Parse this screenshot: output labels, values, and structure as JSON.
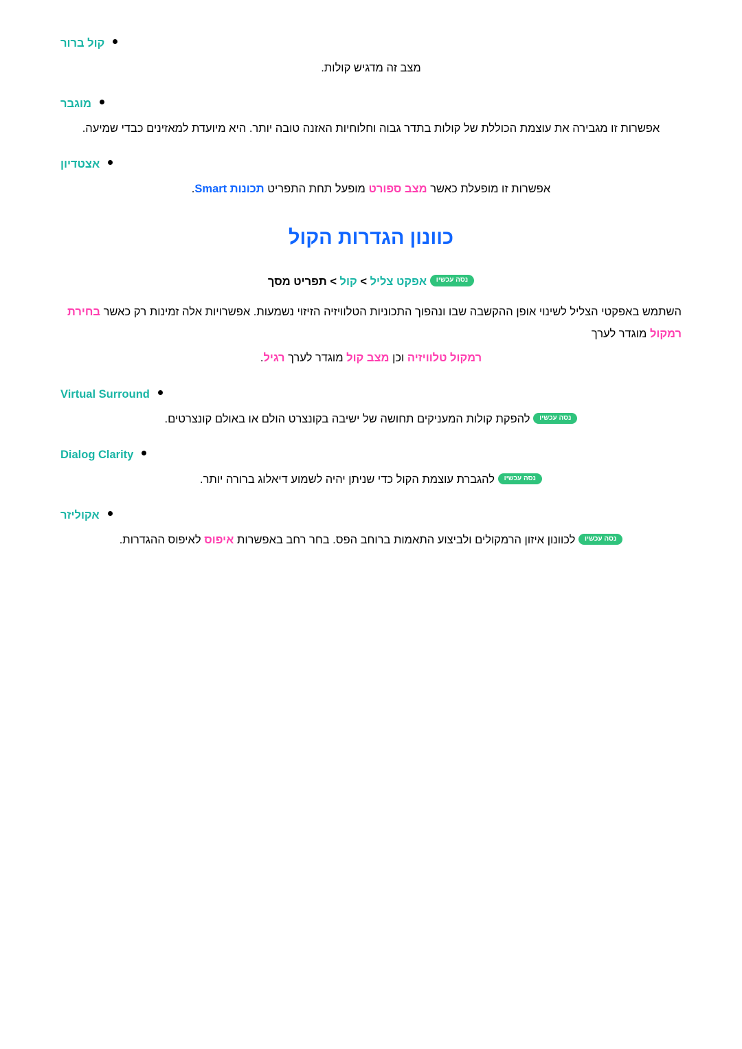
{
  "document": {
    "language": "he",
    "accent_colors": {
      "teal_heading": "#19b5a5",
      "blue_title": "#1166ff",
      "pink_highlight": "#ff3fb0",
      "green_pill": "#2fc37c"
    },
    "try_now_label": "נסה עכשיו",
    "top_items": [
      {
        "id": "clear-sound",
        "label": "קול ברור",
        "description": "מצב זה מדגיש קולות."
      },
      {
        "id": "amplify",
        "label": "מוגבר",
        "description": "אפשרות זו מגבירה את עוצמת הכוללת של קולות בתדר גבוה וחלוחיות האזנה טובה יותר. היא מיועדת למאזינים כבדי שמיעה."
      },
      {
        "id": "adjustment",
        "label": "אצטדיון",
        "description_parts": [
          {
            "text": "אפשרות זו מופעלת כאשר ",
            "style": "plain"
          },
          {
            "text": "מצב ספורט",
            "style": "pink"
          },
          {
            "text": " מופעל תחת התפריט ",
            "style": "plain"
          },
          {
            "text": "תכונות Smart",
            "style": "blue"
          },
          {
            "text": ".",
            "style": "plain"
          }
        ],
        "description_plain": "אפשרות זו מופעלת כאשר מצב ספורט מופעל תחת התפריט תכונות Smart."
      }
    ],
    "section": {
      "title": "כוונון הגדרות הקול",
      "menu_path": {
        "prefix": "תפריט מסך",
        "separator": " > ",
        "items": [
          "קול",
          "אפקט צליל"
        ],
        "full": "תפריט מסך > קול > אפקט צליל"
      },
      "intro_parts": [
        {
          "text": "השתמש באפקטי הצליל לשינוי אופן ההקשבה שבו ונהפוך התכוניות הטלוויזיה הזיזוי נשמעות. אפשרויות אלה זמינות רק כאשר ",
          "style": "plain"
        },
        {
          "text": "בחירת רמקול",
          "style": "pink"
        },
        {
          "text": " מוגדר לערך ",
          "style": "plain"
        },
        {
          "text": "רמקול טלוויזיה",
          "style": "pink"
        },
        {
          "text": " וכן ",
          "style": "plain"
        },
        {
          "text": "מצב קול",
          "style": "pink"
        },
        {
          "text": " מוגדר לערך ",
          "style": "plain"
        },
        {
          "text": "רגיל",
          "style": "pink"
        },
        {
          "text": ".",
          "style": "plain"
        }
      ],
      "intro_line1": "השתמש באפקטי הצליל לשינוי אופן ההקשבה שבו ונהפוך התכוניות הטלוויזיה הזיזוי נשמעות. אפשרויות אלה זמינות רק כאשר בחירת רמקול מוגדר לערך",
      "intro_line2": "רמקול טלוויזיה וכן מצב קול מוגדר לערך רגיל.",
      "effects": [
        {
          "id": "virtual-surround",
          "label": "Virtual Surround",
          "latin": true,
          "description": "להפקת קולות המעניקים תחושה של ישיבה בקונצרט הולם או באולם קונצרטים.",
          "has_try_now": true
        },
        {
          "id": "dialog-clarity",
          "label": "Dialog Clarity",
          "latin": true,
          "description": "להגברת עוצמת הקול כדי שניתן יהיה לשמוע דיאלוג ברורה יותר.",
          "has_try_now": true
        },
        {
          "id": "equalizer",
          "label": "אקוליזר",
          "latin": false,
          "description_parts": [
            {
              "text": "לכוונון איזון הרמקולים ולביצוע התאמות ברוחב הפס. בחר רחב באפשרות ",
              "style": "plain"
            },
            {
              "text": "איפוס",
              "style": "pink"
            },
            {
              "text": " לאיפוס ההגדרות.",
              "style": "plain"
            }
          ],
          "description_plain": "לכוונון איזון הרמקולים ולביצוע התאמות ברוחב הפס. בחר רחב באפשרות איפוס לאיפוס ההגדרות.",
          "has_try_now": true
        }
      ]
    }
  }
}
